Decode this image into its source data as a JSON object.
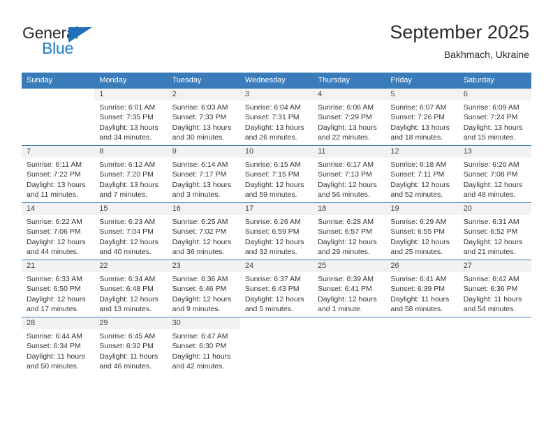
{
  "brand": {
    "name_part1": "General",
    "name_part2": "Blue",
    "triangle_color": "#1f6fb8",
    "blue_color": "#1f7bc1"
  },
  "header": {
    "title": "September 2025",
    "subtitle": "Bakhmach, Ukraine"
  },
  "theme": {
    "header_row_bg": "#3a7cba",
    "day_number_bg": "#f2f2f2",
    "text_color": "#333333"
  },
  "weekdays": [
    "Sunday",
    "Monday",
    "Tuesday",
    "Wednesday",
    "Thursday",
    "Friday",
    "Saturday"
  ],
  "weeks": [
    [
      {
        "day": "",
        "sunrise": "",
        "sunset": "",
        "daylight1": "",
        "daylight2": ""
      },
      {
        "day": "1",
        "sunrise": "Sunrise: 6:01 AM",
        "sunset": "Sunset: 7:35 PM",
        "daylight1": "Daylight: 13 hours",
        "daylight2": "and 34 minutes."
      },
      {
        "day": "2",
        "sunrise": "Sunrise: 6:03 AM",
        "sunset": "Sunset: 7:33 PM",
        "daylight1": "Daylight: 13 hours",
        "daylight2": "and 30 minutes."
      },
      {
        "day": "3",
        "sunrise": "Sunrise: 6:04 AM",
        "sunset": "Sunset: 7:31 PM",
        "daylight1": "Daylight: 13 hours",
        "daylight2": "and 26 minutes."
      },
      {
        "day": "4",
        "sunrise": "Sunrise: 6:06 AM",
        "sunset": "Sunset: 7:29 PM",
        "daylight1": "Daylight: 13 hours",
        "daylight2": "and 22 minutes."
      },
      {
        "day": "5",
        "sunrise": "Sunrise: 6:07 AM",
        "sunset": "Sunset: 7:26 PM",
        "daylight1": "Daylight: 13 hours",
        "daylight2": "and 18 minutes."
      },
      {
        "day": "6",
        "sunrise": "Sunrise: 6:09 AM",
        "sunset": "Sunset: 7:24 PM",
        "daylight1": "Daylight: 13 hours",
        "daylight2": "and 15 minutes."
      }
    ],
    [
      {
        "day": "7",
        "sunrise": "Sunrise: 6:11 AM",
        "sunset": "Sunset: 7:22 PM",
        "daylight1": "Daylight: 13 hours",
        "daylight2": "and 11 minutes."
      },
      {
        "day": "8",
        "sunrise": "Sunrise: 6:12 AM",
        "sunset": "Sunset: 7:20 PM",
        "daylight1": "Daylight: 13 hours",
        "daylight2": "and 7 minutes."
      },
      {
        "day": "9",
        "sunrise": "Sunrise: 6:14 AM",
        "sunset": "Sunset: 7:17 PM",
        "daylight1": "Daylight: 13 hours",
        "daylight2": "and 3 minutes."
      },
      {
        "day": "10",
        "sunrise": "Sunrise: 6:15 AM",
        "sunset": "Sunset: 7:15 PM",
        "daylight1": "Daylight: 12 hours",
        "daylight2": "and 59 minutes."
      },
      {
        "day": "11",
        "sunrise": "Sunrise: 6:17 AM",
        "sunset": "Sunset: 7:13 PM",
        "daylight1": "Daylight: 12 hours",
        "daylight2": "and 56 minutes."
      },
      {
        "day": "12",
        "sunrise": "Sunrise: 6:18 AM",
        "sunset": "Sunset: 7:11 PM",
        "daylight1": "Daylight: 12 hours",
        "daylight2": "and 52 minutes."
      },
      {
        "day": "13",
        "sunrise": "Sunrise: 6:20 AM",
        "sunset": "Sunset: 7:08 PM",
        "daylight1": "Daylight: 12 hours",
        "daylight2": "and 48 minutes."
      }
    ],
    [
      {
        "day": "14",
        "sunrise": "Sunrise: 6:22 AM",
        "sunset": "Sunset: 7:06 PM",
        "daylight1": "Daylight: 12 hours",
        "daylight2": "and 44 minutes."
      },
      {
        "day": "15",
        "sunrise": "Sunrise: 6:23 AM",
        "sunset": "Sunset: 7:04 PM",
        "daylight1": "Daylight: 12 hours",
        "daylight2": "and 40 minutes."
      },
      {
        "day": "16",
        "sunrise": "Sunrise: 6:25 AM",
        "sunset": "Sunset: 7:02 PM",
        "daylight1": "Daylight: 12 hours",
        "daylight2": "and 36 minutes."
      },
      {
        "day": "17",
        "sunrise": "Sunrise: 6:26 AM",
        "sunset": "Sunset: 6:59 PM",
        "daylight1": "Daylight: 12 hours",
        "daylight2": "and 32 minutes."
      },
      {
        "day": "18",
        "sunrise": "Sunrise: 6:28 AM",
        "sunset": "Sunset: 6:57 PM",
        "daylight1": "Daylight: 12 hours",
        "daylight2": "and 29 minutes."
      },
      {
        "day": "19",
        "sunrise": "Sunrise: 6:29 AM",
        "sunset": "Sunset: 6:55 PM",
        "daylight1": "Daylight: 12 hours",
        "daylight2": "and 25 minutes."
      },
      {
        "day": "20",
        "sunrise": "Sunrise: 6:31 AM",
        "sunset": "Sunset: 6:52 PM",
        "daylight1": "Daylight: 12 hours",
        "daylight2": "and 21 minutes."
      }
    ],
    [
      {
        "day": "21",
        "sunrise": "Sunrise: 6:33 AM",
        "sunset": "Sunset: 6:50 PM",
        "daylight1": "Daylight: 12 hours",
        "daylight2": "and 17 minutes."
      },
      {
        "day": "22",
        "sunrise": "Sunrise: 6:34 AM",
        "sunset": "Sunset: 6:48 PM",
        "daylight1": "Daylight: 12 hours",
        "daylight2": "and 13 minutes."
      },
      {
        "day": "23",
        "sunrise": "Sunrise: 6:36 AM",
        "sunset": "Sunset: 6:46 PM",
        "daylight1": "Daylight: 12 hours",
        "daylight2": "and 9 minutes."
      },
      {
        "day": "24",
        "sunrise": "Sunrise: 6:37 AM",
        "sunset": "Sunset: 6:43 PM",
        "daylight1": "Daylight: 12 hours",
        "daylight2": "and 5 minutes."
      },
      {
        "day": "25",
        "sunrise": "Sunrise: 6:39 AM",
        "sunset": "Sunset: 6:41 PM",
        "daylight1": "Daylight: 12 hours",
        "daylight2": "and 1 minute."
      },
      {
        "day": "26",
        "sunrise": "Sunrise: 6:41 AM",
        "sunset": "Sunset: 6:39 PM",
        "daylight1": "Daylight: 11 hours",
        "daylight2": "and 58 minutes."
      },
      {
        "day": "27",
        "sunrise": "Sunrise: 6:42 AM",
        "sunset": "Sunset: 6:36 PM",
        "daylight1": "Daylight: 11 hours",
        "daylight2": "and 54 minutes."
      }
    ],
    [
      {
        "day": "28",
        "sunrise": "Sunrise: 6:44 AM",
        "sunset": "Sunset: 6:34 PM",
        "daylight1": "Daylight: 11 hours",
        "daylight2": "and 50 minutes."
      },
      {
        "day": "29",
        "sunrise": "Sunrise: 6:45 AM",
        "sunset": "Sunset: 6:32 PM",
        "daylight1": "Daylight: 11 hours",
        "daylight2": "and 46 minutes."
      },
      {
        "day": "30",
        "sunrise": "Sunrise: 6:47 AM",
        "sunset": "Sunset: 6:30 PM",
        "daylight1": "Daylight: 11 hours",
        "daylight2": "and 42 minutes."
      },
      {
        "day": "",
        "sunrise": "",
        "sunset": "",
        "daylight1": "",
        "daylight2": ""
      },
      {
        "day": "",
        "sunrise": "",
        "sunset": "",
        "daylight1": "",
        "daylight2": ""
      },
      {
        "day": "",
        "sunrise": "",
        "sunset": "",
        "daylight1": "",
        "daylight2": ""
      },
      {
        "day": "",
        "sunrise": "",
        "sunset": "",
        "daylight1": "",
        "daylight2": ""
      }
    ]
  ]
}
